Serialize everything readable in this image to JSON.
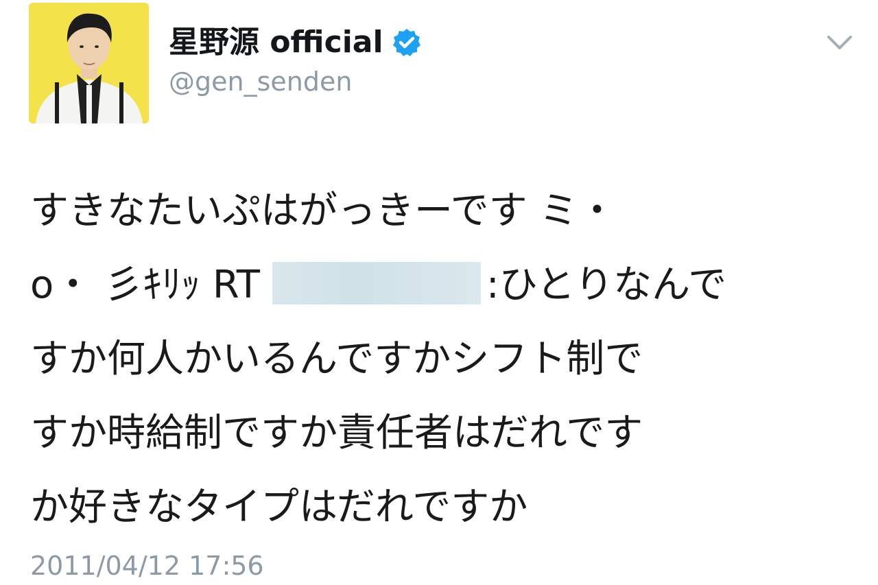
{
  "user": {
    "display_name": "星野源 official",
    "handle": "@gen_senden",
    "verified_icon": "verified-badge-icon"
  },
  "menu": {
    "icon": "chevron-down-icon"
  },
  "tweet": {
    "lines": [
      "すきなたいぷはがっきーです ミ・",
      "o・ 彡ｷﾘｯ RT",
      ":ひとりなんで",
      "すか何人かいるんですかシフト制で",
      "すか時給制ですか責任者はだれです",
      "か好きなタイプはだれですか"
    ]
  },
  "timestamp": "2011/04/12 17:56",
  "colors": {
    "avatar_bg": "#f3e24a",
    "verified_blue": "#1da1f2",
    "secondary_text": "#8b9aa6"
  }
}
